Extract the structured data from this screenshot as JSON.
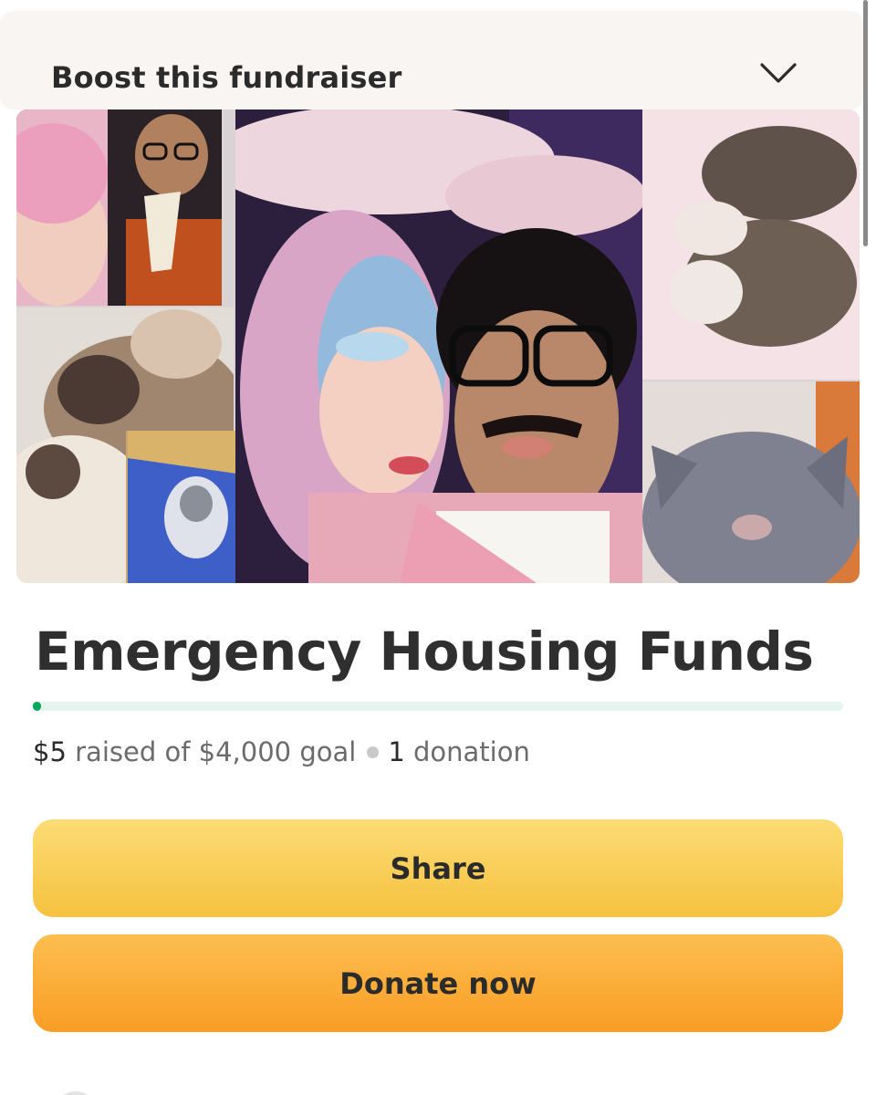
{
  "boost": {
    "title": "Boost this fundraiser",
    "icon": "chevron-down-icon"
  },
  "fundraiser": {
    "title": "Emergency Housing Funds",
    "raised": "$5",
    "raised_label": "raised of",
    "goal": "$4,000",
    "goal_label": "goal",
    "donation_count": "1",
    "donation_label": "donation",
    "progress_fraction": 0.00125
  },
  "actions": {
    "share_label": "Share",
    "donate_label": "Donate now"
  },
  "colors": {
    "progress": "#02a95c",
    "share_button": "#f6c13f",
    "donate_button": "#f99d24"
  }
}
